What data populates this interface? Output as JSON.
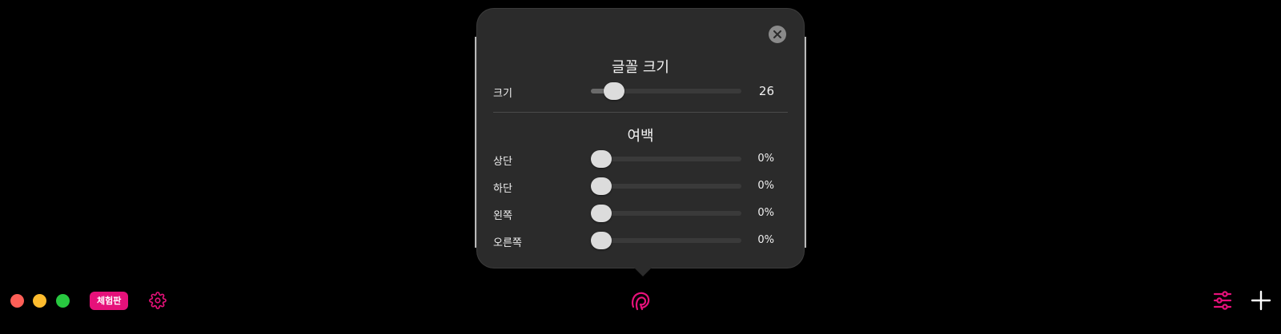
{
  "colors": {
    "accent": "#e6117a",
    "popover_bg": "#2b2b2b",
    "traffic_close": "#fe5f57",
    "traffic_minimize": "#febc2e",
    "traffic_zoom": "#28c840"
  },
  "popover": {
    "close_icon": "close-icon",
    "font_section": {
      "title": "글꼴 크기",
      "size": {
        "label": "크기",
        "value": "26",
        "fraction": 0.1
      }
    },
    "margin_section": {
      "title": "여백",
      "rows": [
        {
          "label": "상단",
          "value": "0%",
          "fraction": 0
        },
        {
          "label": "하단",
          "value": "0%",
          "fraction": 0
        },
        {
          "label": "왼쪽",
          "value": "0%",
          "fraction": 0
        },
        {
          "label": "오른쪽",
          "value": "0%",
          "fraction": 0
        }
      ]
    }
  },
  "bottom_bar": {
    "trial_badge": "체험판",
    "icons": [
      "settings-gear-icon",
      "reader-logo-icon",
      "sliders-icon",
      "plus-icon"
    ]
  }
}
